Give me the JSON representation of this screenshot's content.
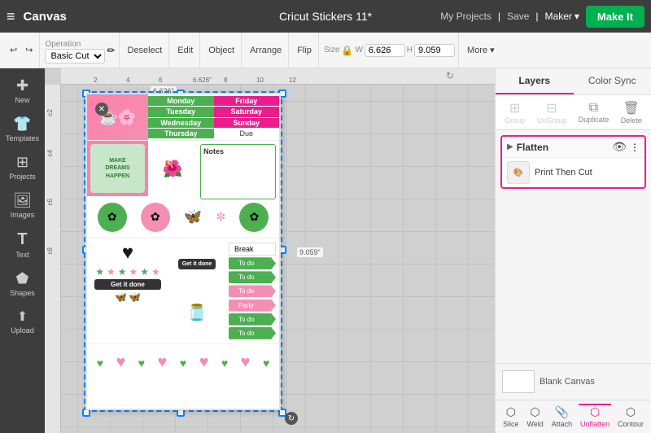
{
  "app": {
    "menu_icon": "≡",
    "canvas_label": "Canvas",
    "project_title": "Cricut Stickers 11*",
    "my_projects": "My Projects",
    "save": "Save",
    "divider": "|",
    "maker": "Maker",
    "make_it": "Make It"
  },
  "toolbar": {
    "undo": "↩",
    "redo": "↪",
    "operation_label": "Operation",
    "operation_value": "Basic Cut",
    "deselect": "Deselect",
    "edit": "Edit",
    "object": "Object",
    "arrange": "Arrange",
    "flip": "Flip",
    "size": "Size",
    "lock_icon": "🔒",
    "w_label": "W",
    "w_value": "6.626",
    "h_label": "H",
    "h_value": "9.059",
    "more": "More ▾"
  },
  "sidebar": {
    "items": [
      {
        "icon": "✚",
        "label": "New"
      },
      {
        "icon": "👕",
        "label": "Templates"
      },
      {
        "icon": "⊞",
        "label": "Projects"
      },
      {
        "icon": "🖼",
        "label": "Images"
      },
      {
        "icon": "T",
        "label": "Text"
      },
      {
        "icon": "⬟",
        "label": "Shapes"
      },
      {
        "icon": "↑",
        "label": "Upload"
      }
    ]
  },
  "right_panel": {
    "tabs": [
      {
        "id": "layers",
        "label": "Layers"
      },
      {
        "id": "color_sync",
        "label": "Color Sync"
      }
    ],
    "toolbar": {
      "group_label": "Group",
      "ungroup_label": "UnGroup",
      "duplicate_label": "Duplicate",
      "delete_label": "Delete"
    },
    "layers": {
      "flatten_group": {
        "label": "Flatten",
        "items": [
          {
            "name": "Print Then Cut",
            "thumb": "🎨"
          }
        ]
      }
    },
    "blank_canvas": {
      "label": "Blank Canvas"
    },
    "bottom_tools": [
      {
        "id": "slice",
        "label": "Slice"
      },
      {
        "id": "weld",
        "label": "Weld"
      },
      {
        "id": "attach",
        "label": "Attach"
      },
      {
        "id": "unflatten",
        "label": "Unflatten",
        "active": true
      },
      {
        "id": "contour",
        "label": "Contour"
      }
    ]
  },
  "canvas": {
    "ruler_marks_h": [
      "2",
      "4",
      "6",
      "8",
      "10",
      "12"
    ],
    "ruler_marks_v": [
      "c2",
      "c4",
      "c6",
      "c8"
    ],
    "width_dim": "6.626\"",
    "height_dim": "9.059\"",
    "sticker": {
      "days": [
        "Monday",
        "Tuesday",
        "Wednesday",
        "Thursday"
      ],
      "days2": [
        "Friday",
        "Saturday",
        "Sunday",
        "Due"
      ],
      "notes": "Notes",
      "items": [
        "Break",
        "To do",
        "To do",
        "To do",
        "Party",
        "To do",
        "To do"
      ],
      "get_it_done": "Get it done",
      "make_dreams": "MAKE\nDREAMS\nHAPPEN"
    }
  }
}
